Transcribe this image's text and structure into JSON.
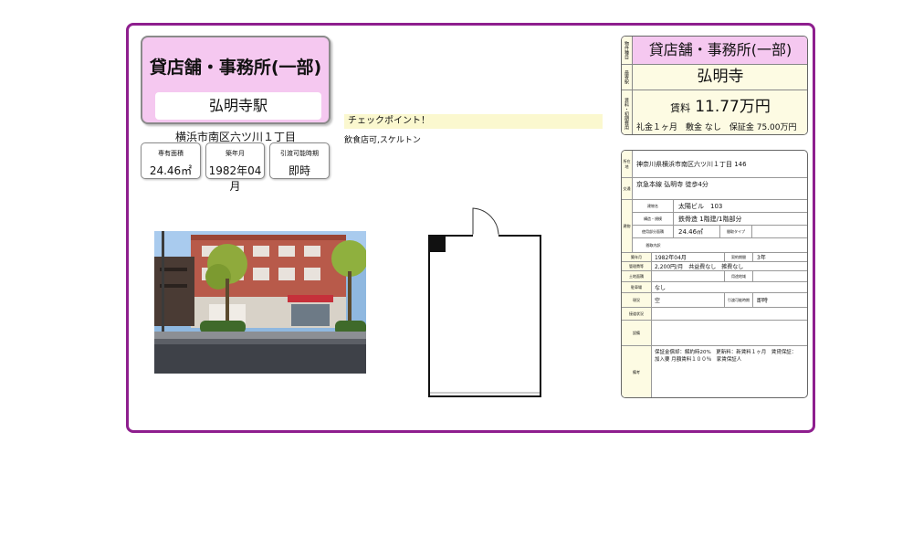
{
  "title_card": {
    "type": "貸店舗・事務所(一部)",
    "station": "弘明寺駅"
  },
  "address": "横浜市南区六ツ川１丁目",
  "info": [
    {
      "label": "専有面積",
      "value": "24.46㎡"
    },
    {
      "label": "築年月",
      "value": "1982年04月"
    },
    {
      "label": "引渡可能時期",
      "value": "即時"
    }
  ],
  "check": {
    "title": "チェックポイント！",
    "text": "飲食店可,スケルトン"
  },
  "summary": {
    "type": "貸店舗・事務所(一部)",
    "station": "弘明寺",
    "rent_label": "賃料",
    "rent_value": "11.77万円",
    "terms": "礼金１ヶ月　敷金 なし　保証金 75.00万円",
    "side_labels": [
      "物件種目",
      "最寄駅",
      "賃料・初期費用"
    ]
  },
  "detail": {
    "address": "神奈川県横浜市南区六ツ川１丁目 146",
    "transport": "京急本線 弘明寺 徒歩4分",
    "building_name": "太陽ビル　103",
    "structure": "鉄骨造 1階建/1階部分",
    "area": "24.46㎡",
    "built": "1982年04月",
    "contract_term": "3年",
    "management_fee": "2,200円/月　共益費なし　雑費なし",
    "parking": "なし",
    "status": "空",
    "handover": "即時",
    "remarks_1": "保証金償却：解約時20%　更新料：新賃料１ヶ月　賃貸保証：",
    "remarks_2": "加入要 月額賃料１００％　家賃保証人",
    "labels": {
      "location": "所在地",
      "traffic": "交通",
      "building_name": "建物名",
      "structure": "構造・規模",
      "area": "使用部分面積",
      "layout_type": "間取タイプ",
      "layout_detail": "間取内訳",
      "built": "築年月",
      "contract": "契約期間",
      "mgmt": "管理費等",
      "land": "土地面積",
      "zoning": "用途地域",
      "parking": "駐車場",
      "status": "現況",
      "handover": "引渡可能時期",
      "vicinity": "接道状況",
      "facilities": "設備",
      "remarks": "備考",
      "building": "建物"
    }
  },
  "colors": {
    "border": "#8e1e8e",
    "title_bg": "#f5c8f0",
    "label_bg": "#fdfbe3",
    "check_bg": "#fbf8cf"
  }
}
